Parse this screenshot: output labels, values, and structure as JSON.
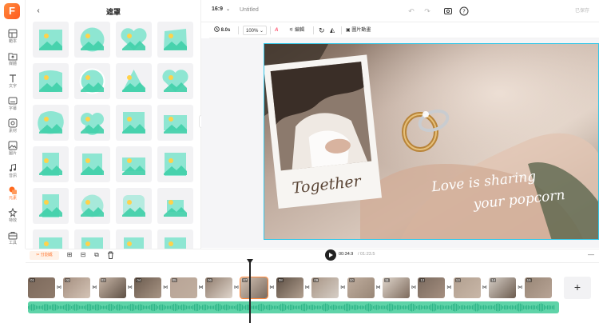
{
  "app": {
    "logo_letter": "F"
  },
  "rail": {
    "items": [
      {
        "label": "範本",
        "icon": "template-icon"
      },
      {
        "label": "媒體",
        "icon": "upload-icon"
      },
      {
        "label": "文字",
        "icon": "text-icon"
      },
      {
        "label": "字幕",
        "icon": "subtitle-icon"
      },
      {
        "label": "素材",
        "icon": "elements-icon"
      },
      {
        "label": "圖片",
        "icon": "image-icon"
      },
      {
        "label": "音訊",
        "icon": "music-icon"
      },
      {
        "label": "元素",
        "icon": "shapes-icon"
      },
      {
        "label": "特效",
        "icon": "effects-icon"
      },
      {
        "label": "工具",
        "icon": "toolbox-icon"
      }
    ],
    "active_index": 7
  },
  "panel": {
    "title": "遮罩",
    "back_icon": "chevron-left-icon",
    "tile_count": 24
  },
  "topbar": {
    "ratio": "16:9",
    "title_placeholder": "Untitled",
    "export_label": "已保存",
    "colors": {
      "accent": "#ff6a1f"
    }
  },
  "editor_toolbar": {
    "duration": "8.0s",
    "zoom": "100%",
    "edit_label": "編輯",
    "animation_label": "圖片動畫"
  },
  "canvas": {
    "text_together": "Together",
    "text_love_line1": "Love is sharing",
    "text_love_line2": "your popcorn",
    "border_color": "#33c7e8"
  },
  "controls": {
    "split_label": "✂ 分割成",
    "current_time": "00:34.9",
    "total_time": "/ 01:23.5"
  },
  "timeline": {
    "clips": [
      "01",
      "02",
      "03",
      "04",
      "05",
      "06",
      "07",
      "08",
      "09",
      "10",
      "11",
      "12",
      "13",
      "14",
      "15"
    ],
    "selected_clip": "07",
    "add_label": "+"
  }
}
